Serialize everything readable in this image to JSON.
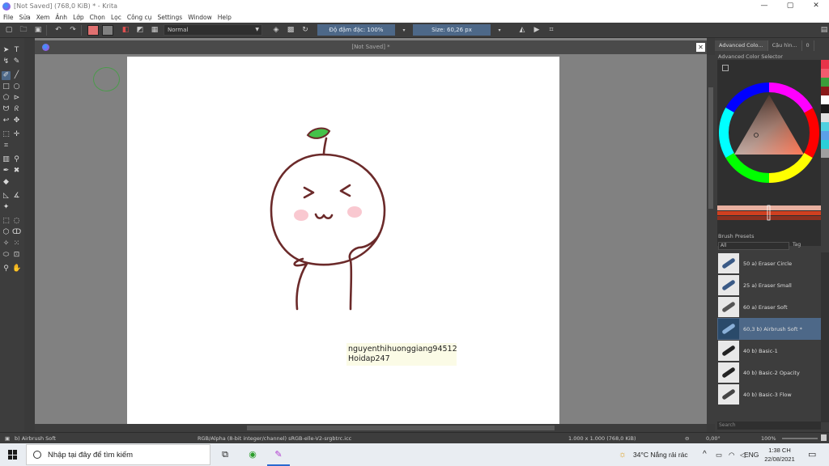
{
  "window": {
    "title": "[Not Saved]  (768,0 KiB)  * - Krita",
    "minimize": "—",
    "maximize": "▢",
    "close": "✕"
  },
  "menu": [
    "File",
    "Sửa",
    "Xem",
    "Ảnh",
    "Lớp",
    "Chọn",
    "Lọc",
    "Công cụ",
    "Settings",
    "Window",
    "Help"
  ],
  "toolbar": {
    "blend_mode": "Normal",
    "opacity_label": "Độ đậm đặc: 100%",
    "size_label": "Size: 60,26 px",
    "fg_color": "#e07070",
    "bg_color": "#808080"
  },
  "document": {
    "tab_title": "[Not Saved]  *",
    "close": "✕"
  },
  "watermark": {
    "line1": "nguyenthihuonggiang94512",
    "line2": "Hoidap247"
  },
  "right_panel": {
    "tabs": [
      "Advanced Colo...",
      "Cậu hìn...",
      "0"
    ],
    "header": "Advanced Color Selector",
    "brush_presets_title": "Brush Presets",
    "filter": "All",
    "tag_label": "Tag",
    "search_placeholder": "Search",
    "brushes": [
      {
        "label": "50   a) Eraser Circle",
        "active": false
      },
      {
        "label": "25   a) Eraser Small",
        "active": false
      },
      {
        "label": "60   a) Eraser Soft",
        "active": false
      },
      {
        "label": "60,3  b) Airbrush Soft *",
        "active": true
      },
      {
        "label": "40   b) Basic-1",
        "active": false
      },
      {
        "label": "40   b) Basic-2 Opacity",
        "active": false
      },
      {
        "label": "40   b) Basic-3 Flow",
        "active": false
      }
    ]
  },
  "status": {
    "brush": "b) Airbrush Soft",
    "colorspace": "RGB/Alpha (8-bit integer/channel)  sRGB-elle-V2-srgbtrc.icc",
    "dimensions": "1.000 x 1.000 (768,0 KiB)",
    "rotation": "0,00°",
    "zoom": "100%"
  },
  "taskbar": {
    "search_placeholder": "Nhập tại đây để tìm kiếm",
    "weather": "34°C  Nắng rải rác",
    "lang": "ENG",
    "time": "1:38 CH",
    "date": "22/08/2021"
  },
  "palette_strip": [
    "#e8334a",
    "#f25b6e",
    "#3a9e3a",
    "#8a1a1a",
    "#ffffff",
    "#1a1a1a",
    "#e0e0e0",
    "#4fd0e0",
    "#5aa0e8",
    "#2ad0d8",
    "#a0a0a0"
  ]
}
